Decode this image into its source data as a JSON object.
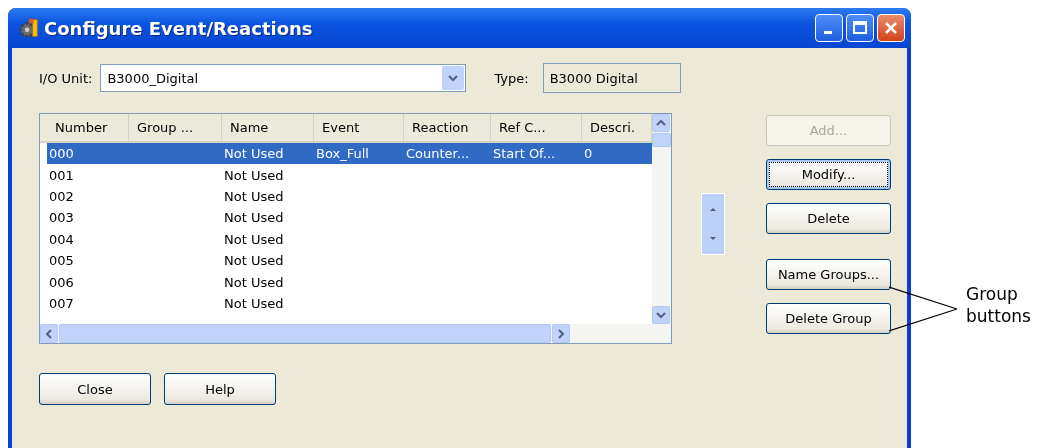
{
  "window": {
    "title": "Configure Event/Reactions"
  },
  "io_unit": {
    "label": "I/O Unit:",
    "value": "B3000_Digital"
  },
  "type": {
    "label": "Type:",
    "value": "B3000 Digital"
  },
  "table": {
    "columns": [
      "Number",
      "Group ...",
      "Name",
      "Event",
      "Reaction",
      "Ref C...",
      "Descri."
    ],
    "rows": [
      {
        "number": "000",
        "name": "Not Used",
        "event": "Box_Full",
        "reaction": "Counter...",
        "ref": "Start Of...",
        "description": "0",
        "selected": true
      },
      {
        "number": "001",
        "name": "Not Used",
        "selected": false
      },
      {
        "number": "002",
        "name": "Not Used",
        "selected": false
      },
      {
        "number": "003",
        "name": "Not Used",
        "selected": false
      },
      {
        "number": "004",
        "name": "Not Used",
        "selected": false
      },
      {
        "number": "005",
        "name": "Not Used",
        "selected": false
      },
      {
        "number": "006",
        "name": "Not Used",
        "selected": false
      },
      {
        "number": "007",
        "name": "Not Used",
        "selected": false
      }
    ]
  },
  "side_buttons": [
    {
      "label": "Add...",
      "disabled": true,
      "focused": false
    },
    {
      "label": "Modify...",
      "disabled": false,
      "focused": true
    },
    {
      "label": "Delete",
      "disabled": false,
      "focused": false
    },
    {
      "label": "Name Groups...",
      "disabled": false,
      "focused": false
    },
    {
      "label": "Delete Group",
      "disabled": false,
      "focused": false
    }
  ],
  "bottom_buttons": [
    {
      "label": "Close",
      "disabled": false
    },
    {
      "label": "Help",
      "disabled": false
    }
  ],
  "callout": {
    "text": "Group buttons"
  }
}
